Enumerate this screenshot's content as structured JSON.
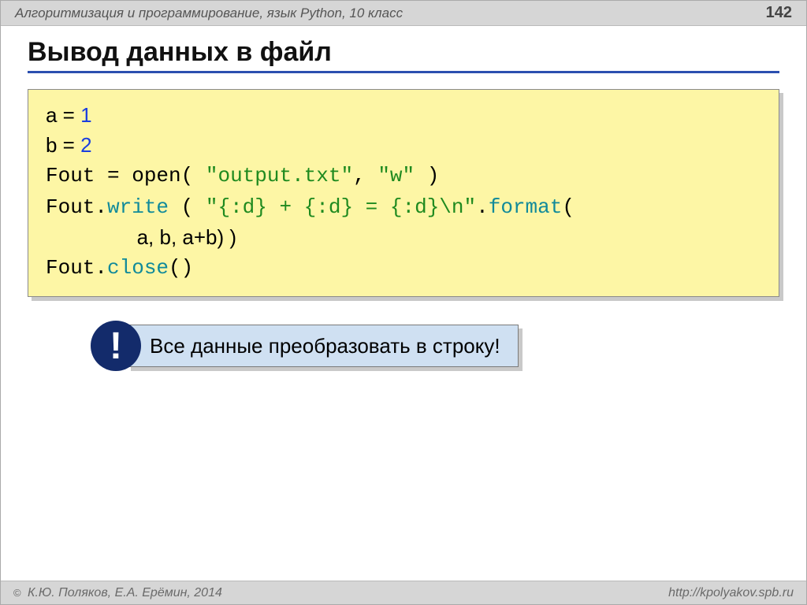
{
  "header": {
    "course": "Алгоритмизация и программирование, язык Python, 10 класс",
    "page_num": "142"
  },
  "title": "Вывод данных в файл",
  "code": {
    "l1_a": "a = ",
    "l1_b": "1",
    "l2_a": "b = ",
    "l2_b": "2",
    "l3_a": "Fout = open",
    "l3_b": "( ",
    "l3_c": "\"output.txt\"",
    "l3_d": ", ",
    "l3_e": "\"w\"",
    "l3_f": " )",
    "l4_a": "Fout.",
    "l4_b": "write",
    "l4_c": " ( ",
    "l4_d": "\"{:d} + {:d} = {:d}\\n\"",
    "l4_e": ".",
    "l4_f": "format",
    "l4_g": "(",
    "l5_a": "                a, b, a+b) )",
    "l6_a": "Fout.",
    "l6_b": "close",
    "l6_c": "()"
  },
  "callout": {
    "badge": "!",
    "text": "Все данные преобразовать в строку!"
  },
  "footer": {
    "copyright_sym": "©",
    "authors": " К.Ю. Поляков, Е.А. Ерёмин, 2014",
    "url": "http://kpolyakov.spb.ru"
  }
}
